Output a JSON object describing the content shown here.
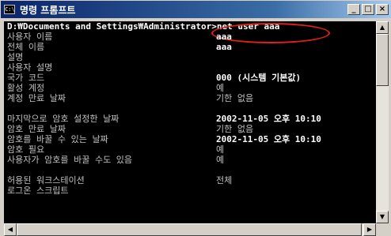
{
  "window": {
    "title": "명령 프롬프트",
    "icon_label": "C:\\",
    "controls": {
      "minimize": "_",
      "maximize": "□",
      "close": "×"
    }
  },
  "console": {
    "prompt_path": "D:₩Documents and Settings₩Administrator>",
    "command": "net user aaa",
    "rows": [
      {
        "key": "사용자 이름",
        "value": "aaa",
        "bold": true
      },
      {
        "key": "전체 이름",
        "value": "aaa",
        "bold": true
      },
      {
        "key": "설명",
        "value": ""
      },
      {
        "key": "사용자 설명",
        "value": ""
      },
      {
        "key": "국가 코드",
        "value": "000 (시스템 기본값)",
        "bold": true
      },
      {
        "key": "활성 계정",
        "value": "예"
      },
      {
        "key": "계정 만료 날짜",
        "value": "기한 없음"
      },
      {
        "key": "",
        "value": ""
      },
      {
        "key": "마지막으로 암호 설정한 날짜",
        "value": "2002-11-05 오후 10:10",
        "bold": true
      },
      {
        "key": "암호 만료 날짜",
        "value": "기한 없음"
      },
      {
        "key": "암호를 바꿀 수 있는 날짜",
        "value": "2002-11-05 오후 10:10",
        "bold": true
      },
      {
        "key": "암호 필요",
        "value": "예"
      },
      {
        "key": "사용자가 암호를 바꿀 수도 있음",
        "value": "예"
      },
      {
        "key": "",
        "value": ""
      },
      {
        "key": "허용된 워크스테이션",
        "value": "전체"
      },
      {
        "key": "로그온 스크립트",
        "value": ""
      }
    ]
  },
  "scroll": {
    "up_arrow": "▲",
    "down_arrow": "▼",
    "left_arrow": "◀",
    "right_arrow": "▶"
  },
  "colors": {
    "highlight_circle": "#e0201b",
    "console_bg": "#000000",
    "console_text": "#c0c0c0"
  }
}
